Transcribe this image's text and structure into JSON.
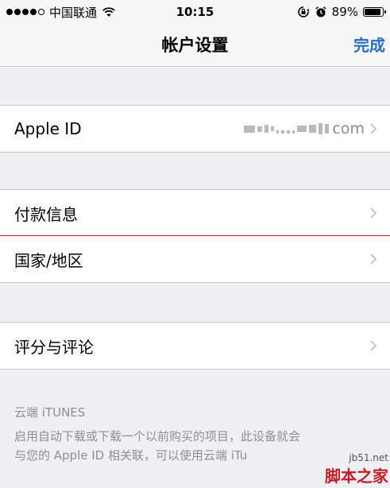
{
  "status_bar": {
    "carrier": "中国联通",
    "time": "10:15",
    "battery": "89%",
    "battery_level": 0.89,
    "signal_filled": 4,
    "signal_total": 5
  },
  "nav": {
    "title": "帐户设置",
    "done_label": "完成"
  },
  "groups": [
    {
      "items": [
        {
          "label": "Apple ID",
          "value": "com"
        }
      ]
    },
    {
      "items": [
        {
          "label": "付款信息"
        },
        {
          "label": "国家/地区"
        }
      ]
    },
    {
      "items": [
        {
          "label": "评分与评论"
        }
      ]
    }
  ],
  "footer": {
    "title": "云端 iTUNES",
    "line1": "启用自动下载或下载一个以前购买的项目，此设备就会",
    "line2": "与您的 Apple ID 相关联，可以使用云端 iTu"
  },
  "watermark": {
    "url": "jb51.net",
    "name": "脚本之家"
  },
  "colors": {
    "accent": "#2a6fbd",
    "background": "#efeff4",
    "secondary_text": "#8e8e93",
    "separator_highlight": "#c0202a"
  }
}
